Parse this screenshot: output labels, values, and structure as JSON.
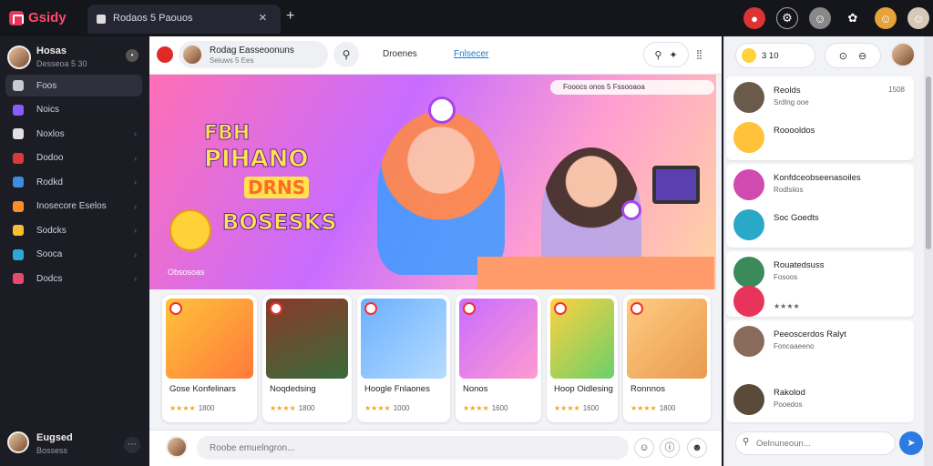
{
  "browser": {
    "brand": "Gsidy",
    "tab_title": "Rodaos 5 Paouos",
    "tab_close": "×",
    "new_tab": "+"
  },
  "sidebar": {
    "profile_name": "Hosas",
    "profile_sub": "Desseoa 5 30",
    "items": [
      {
        "label": "Foos",
        "color": "#c9c9d4",
        "active": true
      },
      {
        "label": "Noics",
        "color": "#8a5cff"
      },
      {
        "label": "Noxlos",
        "color": "#e0e0e6"
      },
      {
        "label": "Dodoo",
        "color": "#d83a3a"
      },
      {
        "label": "Rodkd",
        "color": "#3a8ee0"
      },
      {
        "label": "Inosecore Eselos",
        "color": "#ff8c2a"
      },
      {
        "label": "Sodcks",
        "color": "#f5c030"
      },
      {
        "label": "Sooca",
        "color": "#2ba8d8"
      },
      {
        "label": "Dodcs",
        "color": "#e84a6a"
      }
    ],
    "footer_name": "Eugsed",
    "footer_sub": "Bossess"
  },
  "main": {
    "chip_title": "Rodag Easseoonuns",
    "chip_sub": "Seiuws 5 Ees",
    "tabs": [
      "Droenes",
      "Fnlsecer"
    ],
    "hero": {
      "line1": "FBH",
      "line2": "PIHANO",
      "line3": "DRNS",
      "line4": "BOSESKS",
      "caption": "Obsosoas",
      "badge": "Fooocs onos 5 Fssooaoa"
    },
    "cards": [
      {
        "title": "Gose Konfelinars",
        "rating": "★★★★",
        "count": "1800",
        "bg": "linear-gradient(135deg,#ffc23a,#ff7a3a)"
      },
      {
        "title": "Noqdedsing",
        "rating": "★★★★",
        "count": "1800",
        "bg": "linear-gradient(160deg,#8a3a2a,#3a6a3a)"
      },
      {
        "title": "Hoogle Fnlaones",
        "rating": "★★★★",
        "count": "1000",
        "bg": "linear-gradient(135deg,#6ab0ff,#b6dcff)"
      },
      {
        "title": "Nonos",
        "rating": "★★★★",
        "count": "1600",
        "bg": "linear-gradient(135deg,#c86cff,#ff9ad0)"
      },
      {
        "title": "Hoop Oidlesing",
        "rating": "★★★★",
        "count": "1600",
        "bg": "linear-gradient(135deg,#ffd040,#6ad06a)"
      },
      {
        "title": "Ronnnos",
        "rating": "★★★★",
        "count": "1800",
        "bg": "linear-gradient(135deg,#ffcc80,#e89a50)"
      }
    ],
    "composer_placeholder": "Roobe emuelngron..."
  },
  "right": {
    "chip_label": "3 10",
    "feed": [
      {
        "name": "Reolds",
        "sub": "Srdlng ooe",
        "time": "1508",
        "ava": "#6a5a4a"
      },
      {
        "name": "Rooooldos",
        "sub": "",
        "time": "",
        "ava": "#ffc23a"
      },
      {
        "name": "Konfdceobseenasoiles",
        "sub": "Rodlsiios",
        "time": "",
        "ava": "#d04ab0"
      },
      {
        "name": "Soc Goedts",
        "sub": "",
        "time": "",
        "ava": "#2aa8c8"
      },
      {
        "name": "Rouatedsuss",
        "sub": "Fosoos",
        "time": "",
        "ava": "#3a8a5a"
      },
      {
        "name": "",
        "sub": "★★★★",
        "time": "",
        "ava": "#e8345a"
      },
      {
        "name": "Peeoscerdos Ralyt",
        "sub": "Foncaaeeno",
        "time": "",
        "ava": "#8a6a5a"
      },
      {
        "name": "Rakolod",
        "sub": "Pooedos",
        "time": "",
        "ava": "#5a4a3a"
      }
    ],
    "search_placeholder": "Oelnuneoun..."
  }
}
